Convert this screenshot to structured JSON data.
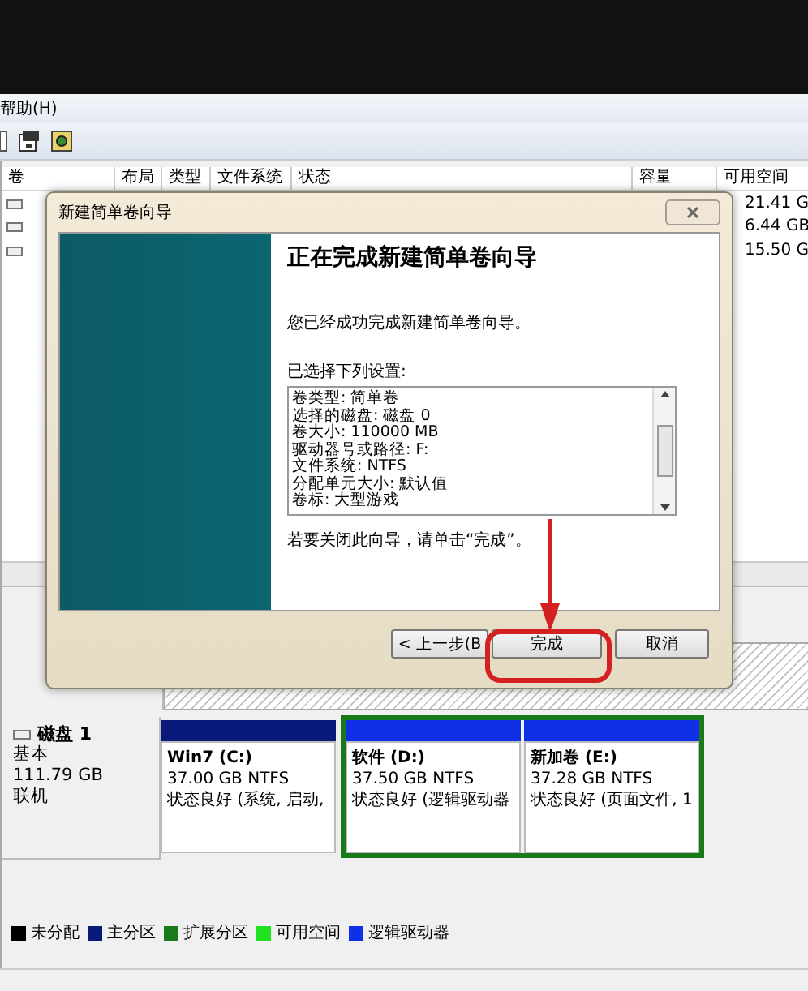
{
  "menu": [
    {
      "label": "帮助(H)"
    }
  ],
  "volume_table": {
    "columns": [
      "卷",
      "布局",
      "类型",
      "文件系统",
      "状态",
      "容量",
      "可用空间"
    ],
    "rows": [
      {
        "free_space": "21.41 G"
      },
      {
        "free_space": "6.44 GB"
      },
      {
        "free_space": "15.50 G"
      }
    ]
  },
  "wizard": {
    "title": "新建简单卷向导",
    "heading": "正在完成新建简单卷向导",
    "intro": "您已经成功完成新建简单卷向导。",
    "settings_label": "已选择下列设置:",
    "settings": [
      "卷类型: 简单卷",
      "选择的磁盘: 磁盘 0",
      "卷大小: 110000 MB",
      "驱动器号或路径: F:",
      "文件系统: NTFS",
      "分配单元大小: 默认值",
      "卷标: 大型游戏"
    ],
    "closing_note": "若要关闭此向导，请单击“完成”。",
    "buttons": [
      {
        "label": "< 上一步(B",
        "kind": "back"
      },
      {
        "label": "完成",
        "kind": "finish"
      },
      {
        "label": "取消",
        "kind": "cancel"
      }
    ]
  },
  "disk": {
    "name": "磁盘 1",
    "type": "基本",
    "size": "111.79 GB",
    "status": "联机",
    "partitions": [
      {
        "name": "Win7 (C:)",
        "size": "37.00 GB NTFS",
        "status": "状态良好 (系统, 启动,",
        "kind": "primary"
      },
      {
        "name": "软件 (D:)",
        "size": "37.50 GB NTFS",
        "status": "状态良好 (逻辑驱动器",
        "kind": "logical"
      },
      {
        "name": "新加卷 (E:)",
        "size": "37.28 GB NTFS",
        "status": "状态良好 (页面文件, 1",
        "kind": "logical"
      }
    ]
  },
  "legend": [
    {
      "label": "未分配",
      "color": "#000000"
    },
    {
      "label": "主分区",
      "color": "#0a1a7a"
    },
    {
      "label": "扩展分区",
      "color": "#1a7a1a"
    },
    {
      "label": "可用空间",
      "color": "#22e022"
    },
    {
      "label": "逻辑驱动器",
      "color": "#1030e8"
    }
  ]
}
